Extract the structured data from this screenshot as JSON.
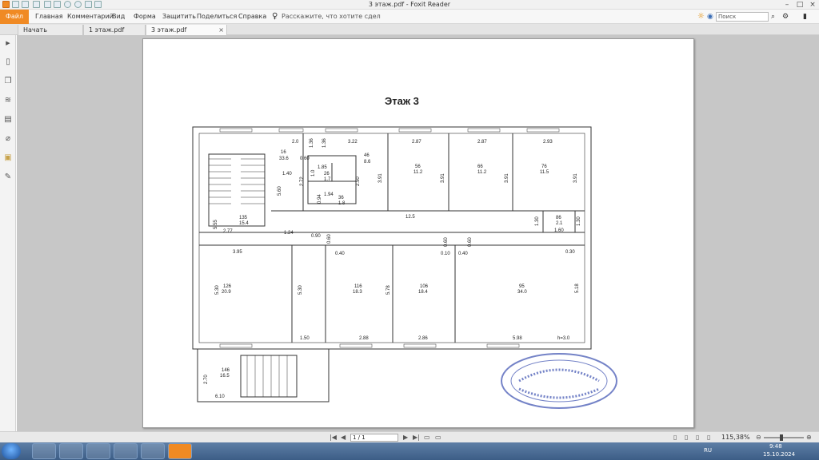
{
  "window": {
    "title": "3 этаж.pdf - Foxit Reader"
  },
  "quick_access": {
    "icons": [
      "app-icon",
      "open-icon",
      "save-icon",
      "print-icon",
      "new-icon",
      "undo-icon",
      "redo-icon",
      "hand-icon",
      "select-icon"
    ]
  },
  "menu": {
    "file": "Файл",
    "items": [
      "Главная",
      "Комментарий",
      "Вид",
      "Форма",
      "Защитить",
      "Поделиться",
      "Справка"
    ],
    "tell_me": "Расскажите, что хотите сдел",
    "search_placeholder": "Поиск"
  },
  "tabs": [
    {
      "label": "Начать"
    },
    {
      "label": "1 этаж.pdf"
    },
    {
      "label": "3 этаж.pdf",
      "active": true,
      "close": "×"
    }
  ],
  "left_panel": {
    "icons": [
      "arrow-icon",
      "bookmark-icon",
      "pages-icon",
      "layers-icon",
      "comments-icon",
      "attachment-icon",
      "security-icon",
      "signature-icon"
    ]
  },
  "document": {
    "title": "Этаж 3",
    "dimensions": [
      "2.0",
      "1.36",
      "1.36",
      "3.22",
      "2.87",
      "2.87",
      "2.93",
      "16",
      "33.6",
      "0.60",
      "46",
      "8.6",
      "1.40",
      "1.85",
      "26",
      "1.7",
      "1.0",
      "2.72",
      "2.50",
      "5.60",
      "1.94",
      "36",
      "1.8",
      "0.94",
      "56",
      "11.2",
      "3.91",
      "66",
      "11.2",
      "3.91",
      "76",
      "11.5",
      "3.91",
      "3.91",
      "12.5",
      "1.30",
      "86",
      "2.1",
      "1.30",
      "1.60",
      "135",
      "15.4",
      "5.55",
      "2.77",
      "1.24",
      "0.90",
      "3.95",
      "0.60",
      "0.40",
      "0.60",
      "0.10",
      "0.40",
      "0.60",
      "0.30",
      "126",
      "20.9",
      "5.30",
      "5.30",
      "116",
      "18.3",
      "5.78",
      "106",
      "18.4",
      "95",
      "34.0",
      "5.18",
      "1.50",
      "2.88",
      "2.86",
      "5.98",
      "h=3.0",
      "146",
      "16.5",
      "2.70",
      "6.10"
    ]
  },
  "status": {
    "page": "1 / 1",
    "zoom": "115,38%"
  },
  "taskbar": {
    "lang": "RU",
    "time": "9:48",
    "date": "15.10.2024"
  }
}
